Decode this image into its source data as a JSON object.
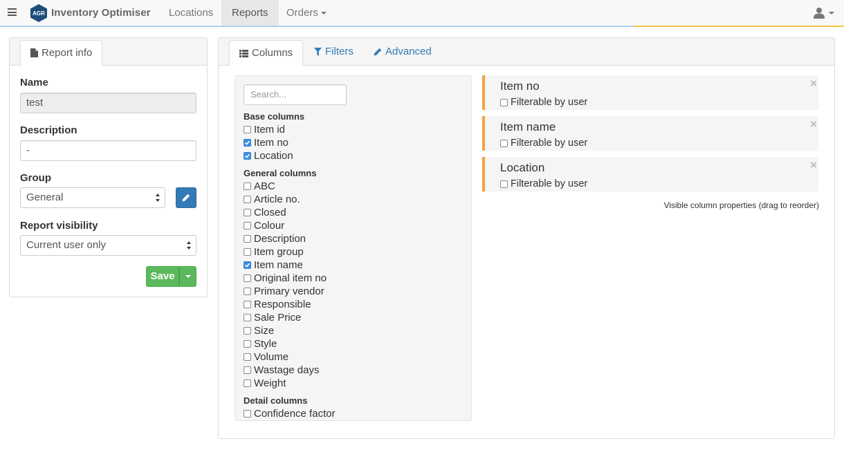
{
  "navbar": {
    "brand_logo_text": "AGR",
    "brand_title": "Inventory Optimiser",
    "links": [
      {
        "label": "Locations"
      },
      {
        "label": "Reports"
      },
      {
        "label": "Orders"
      }
    ],
    "user_icon": "user-icon"
  },
  "left_panel": {
    "tab_label": "Report info",
    "name_label": "Name",
    "name_value": "test",
    "description_label": "Description",
    "description_value": "-",
    "group_label": "Group",
    "group_value": "General",
    "visibility_label": "Report visibility",
    "visibility_value": "Current user only",
    "save_label": "Save"
  },
  "right_panel": {
    "tabs": [
      {
        "label": "Columns"
      },
      {
        "label": "Filters"
      },
      {
        "label": "Advanced"
      }
    ],
    "search_placeholder": "Search...",
    "base_columns_heading": "Base columns",
    "base_columns": [
      {
        "label": "Item id",
        "checked": false
      },
      {
        "label": "Item no",
        "checked": true
      },
      {
        "label": "Location",
        "checked": true
      }
    ],
    "general_columns_heading": "General columns",
    "general_columns": [
      {
        "label": "ABC",
        "checked": false
      },
      {
        "label": "Article no.",
        "checked": false
      },
      {
        "label": "Closed",
        "checked": false
      },
      {
        "label": "Colour",
        "checked": false
      },
      {
        "label": "Description",
        "checked": false
      },
      {
        "label": "Item group",
        "checked": false
      },
      {
        "label": "Item name",
        "checked": true
      },
      {
        "label": "Original item no",
        "checked": false
      },
      {
        "label": "Primary vendor",
        "checked": false
      },
      {
        "label": "Responsible",
        "checked": false
      },
      {
        "label": "Sale Price",
        "checked": false
      },
      {
        "label": "Size",
        "checked": false
      },
      {
        "label": "Style",
        "checked": false
      },
      {
        "label": "Volume",
        "checked": false
      },
      {
        "label": "Wastage days",
        "checked": false
      },
      {
        "label": "Weight",
        "checked": false
      }
    ],
    "detail_columns_heading": "Detail columns",
    "detail_columns": [
      {
        "label": "Confidence factor",
        "checked": false
      }
    ],
    "visible_columns": [
      {
        "name": "Item no",
        "filter_label": "Filterable by user",
        "filterable": false
      },
      {
        "name": "Item name",
        "filter_label": "Filterable by user",
        "filterable": false
      },
      {
        "name": "Location",
        "filter_label": "Filterable by user",
        "filterable": false
      }
    ],
    "close_glyph": "×",
    "hint": "Visible column properties (drag to reorder)"
  },
  "colors": {
    "primary": "#337ab7",
    "success": "#5cb85c",
    "accent_orange": "#f4a13c",
    "checkbox_checked": "#3b8fe0",
    "nav_accent_blue": "#aed3ee",
    "nav_accent_yellow": "#f6c343"
  }
}
